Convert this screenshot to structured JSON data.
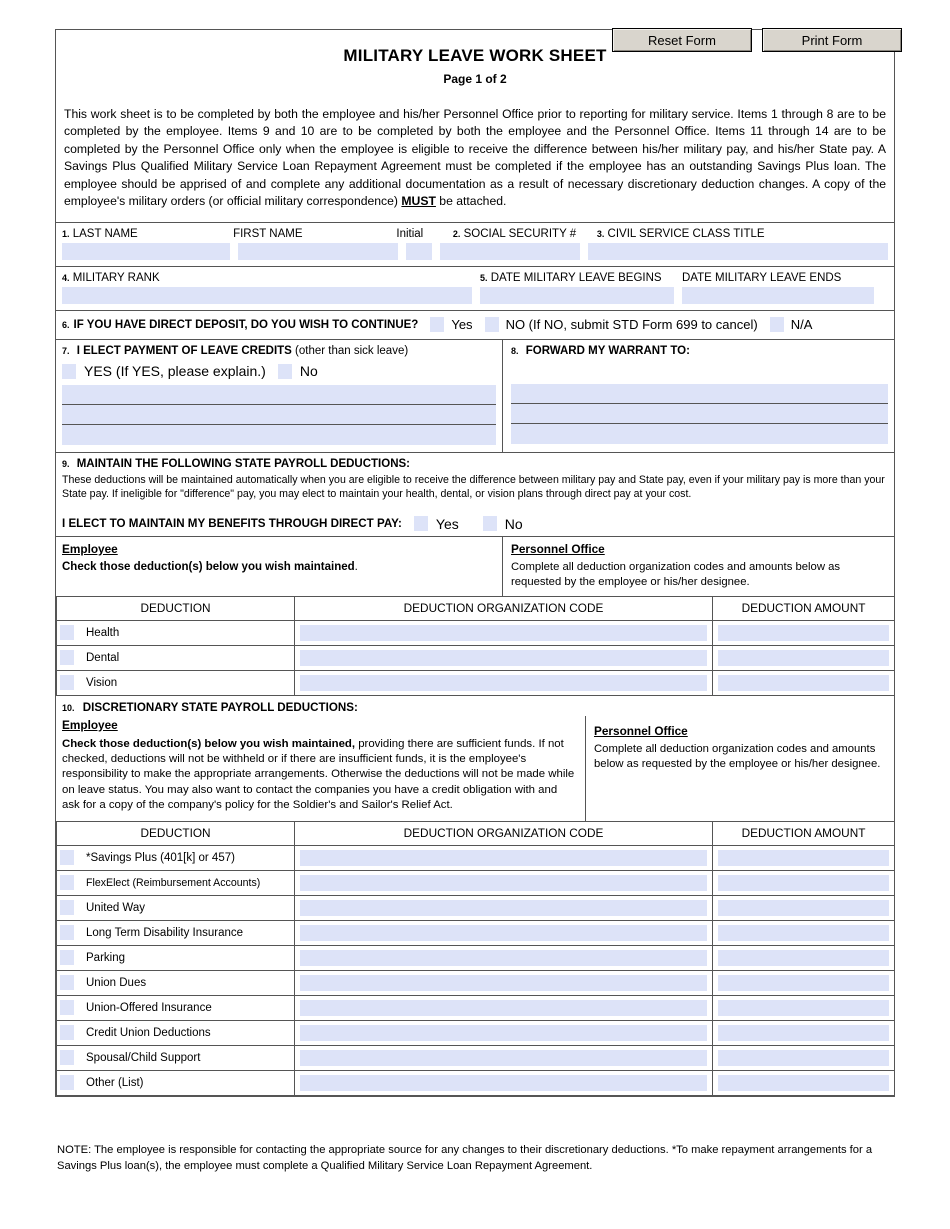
{
  "toolbar": {
    "reset_label": "Reset Form",
    "print_label": "Print Form"
  },
  "header": {
    "title": "MILITARY LEAVE WORK SHEET",
    "subtitle": "Page 1 of 2"
  },
  "intro": {
    "text_part1": "This work sheet is to be completed by both the employee and his/her Personnel Office prior to reporting for military service.  Items 1 through 8 are to be completed by the employee.  Items 9 and 10 are to be completed by both the employee and the Personnel Office.  Items 11 through 14 are to be completed by the Personnel Office only when the employee is eligible to receive the difference between his/her military pay, and his/her State pay.  A Savings Plus Qualified Military Service Loan Repayment Agreement must be completed if the employee has an outstanding Savings Plus loan.  The employee should be apprised of and complete any additional documentation as a result of necessary discretionary deduction changes.  A copy of the employee's military orders (or official military correspondence) ",
    "must": "MUST",
    "text_part2": " be attached."
  },
  "identity": {
    "last_name_num": "1.",
    "last_name_label": "LAST NAME",
    "first_name_label": "FIRST NAME",
    "initial_label": "Initial",
    "ssn_num": "2.",
    "ssn_label": "SOCIAL SECURITY #",
    "class_num": "3.",
    "class_label": "CIVIL SERVICE CLASS TITLE",
    "last_name_value": "",
    "first_name_value": "",
    "initial_value": "",
    "ssn_value": "",
    "class_value": ""
  },
  "military": {
    "rank_num": "4.",
    "rank_label": "MILITARY RANK",
    "dates_num": "5.",
    "begins_label": "DATE MILITARY LEAVE BEGINS",
    "ends_label": "DATE MILITARY LEAVE ENDS",
    "rank_value": "",
    "begins_value": "",
    "ends_value": ""
  },
  "direct_deposit": {
    "num": "6.",
    "question": "IF YOU HAVE DIRECT DEPOSIT, DO YOU WISH TO CONTINUE?",
    "yes_label": "Yes",
    "no_label": "NO (If NO, submit STD Form 699 to cancel)",
    "na_label": "N/A"
  },
  "item7": {
    "num": "7.",
    "title_bold": "I ELECT PAYMENT OF LEAVE CREDITS",
    "title_rest": "(other than sick leave)",
    "yes_label": "YES  (If YES, please explain.)",
    "no_label": "No",
    "line1_value": "",
    "line2_value": "",
    "line3_value": ""
  },
  "item8": {
    "num": "8.",
    "title": "FORWARD MY WARRANT TO:",
    "line1_value": "",
    "line2_value": "",
    "line3_value": ""
  },
  "item9": {
    "num": "9.",
    "title": "MAINTAIN THE FOLLOWING STATE PAYROLL DEDUCTIONS:",
    "paragraph": "These deductions will be maintained automatically when you are eligible to receive the difference between military pay and State pay, even if your military pay is more than your State pay.  If ineligible for \"difference\" pay, you may elect to maintain your health, dental, or vision plans through direct pay at your cost.",
    "elect_label": "I ELECT TO MAINTAIN MY BENEFITS THROUGH DIRECT PAY:",
    "yes_label": "Yes",
    "no_label": "No",
    "employee_header": "Employee",
    "employee_text": "Check those deduction(s) below you wish maintained",
    "employee_text_period": ".",
    "personnel_header": "Personnel Office",
    "personnel_text": "Complete all deduction organization codes and amounts below as requested by the employee or his/her designee.",
    "columns": [
      "DEDUCTION",
      "DEDUCTION ORGANIZATION CODE",
      "DEDUCTION AMOUNT"
    ],
    "rows": [
      {
        "name": "Health",
        "code": "",
        "amount": ""
      },
      {
        "name": "Dental",
        "code": "",
        "amount": ""
      },
      {
        "name": "Vision",
        "code": "",
        "amount": ""
      }
    ]
  },
  "item10": {
    "num": "10.",
    "title": "DISCRETIONARY STATE PAYROLL DEDUCTIONS:",
    "employee_header": "Employee",
    "employee_bold": "Check those deduction(s) below you wish maintained,",
    "employee_rest": " providing there are sufficient funds. If not checked, deductions will not be withheld or if there are insufficient funds, it is the employee's responsibility to make the appropriate arrangements.  Otherwise the deductions will not be made while on leave status.  You may also want to contact the companies you have a credit obligation with and ask for a copy of the company's policy for the Soldier's and Sailor's Relief Act.",
    "personnel_header": "Personnel Office",
    "personnel_text": "Complete all deduction organization codes and amounts below as requested by the employee or his/her designee.",
    "columns": [
      "DEDUCTION",
      "DEDUCTION ORGANIZATION CODE",
      "DEDUCTION AMOUNT"
    ],
    "rows": [
      {
        "name": "*Savings Plus (401[k] or 457)",
        "code": "",
        "amount": "",
        "small": false
      },
      {
        "name": "FlexElect (Reimbursement Accounts)",
        "code": "",
        "amount": "",
        "small": true
      },
      {
        "name": "United Way",
        "code": "",
        "amount": "",
        "small": false
      },
      {
        "name": "Long Term Disability Insurance",
        "code": "",
        "amount": "",
        "small": false
      },
      {
        "name": "Parking",
        "code": "",
        "amount": "",
        "small": false
      },
      {
        "name": "Union Dues",
        "code": "",
        "amount": "",
        "small": false
      },
      {
        "name": "Union-Offered Insurance",
        "code": "",
        "amount": "",
        "small": false
      },
      {
        "name": "Credit Union Deductions",
        "code": "",
        "amount": "",
        "small": false
      },
      {
        "name": "Spousal/Child Support",
        "code": "",
        "amount": "",
        "small": false
      },
      {
        "name": "Other (List)",
        "code": "",
        "amount": "",
        "small": false
      }
    ]
  },
  "footer": {
    "note": "NOTE:  The employee is responsible for contacting the appropriate source for any changes to their discretionary deductions.  *To make repayment arrangements for a Savings Plus loan(s), the employee must complete a Qualified Military Service Loan Repayment Agreement."
  },
  "colors": {
    "field_fill": "#dde3f8",
    "border": "#555555",
    "button_face": "#d9d5cd"
  }
}
